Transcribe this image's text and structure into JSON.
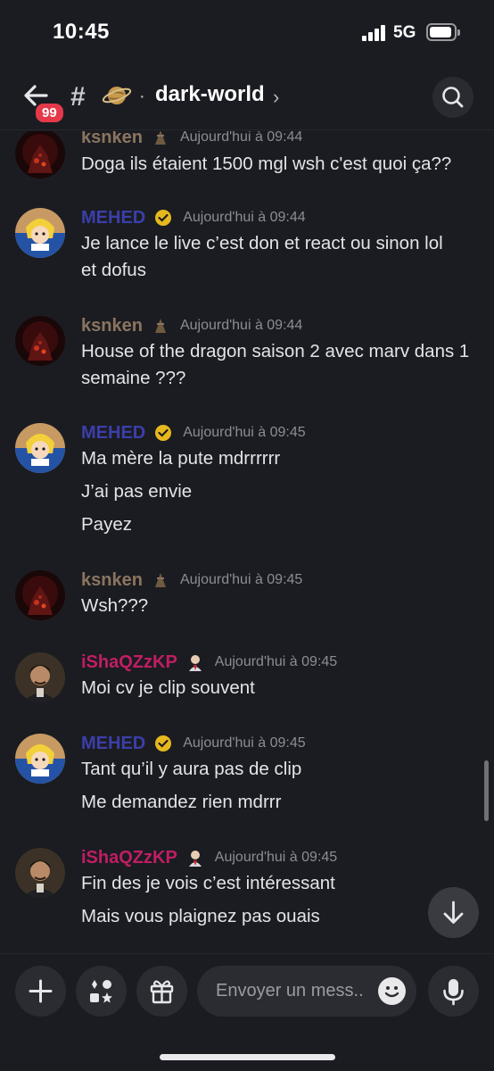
{
  "status_bar": {
    "time": "10:45",
    "network": "5G"
  },
  "header": {
    "badge_count": "99",
    "hash_symbol": "#",
    "separator": "·",
    "channel_name": "dark-world",
    "chevron": "›"
  },
  "messages": [
    {
      "author": "ksnken",
      "timestamp": "Aujourd'hui à 09:44",
      "lines": [
        "Doga ils étaient 1500 mgl wsh c'est quoi ça??"
      ]
    },
    {
      "author": "MEHED",
      "timestamp": "Aujourd'hui à 09:44",
      "lines": [
        "Je lance le live c’est don et react ou sinon lol",
        "et dofus"
      ]
    },
    {
      "author": "ksnken",
      "timestamp": "Aujourd'hui à 09:44",
      "lines": [
        "House of the dragon saison 2 avec marv dans 1",
        "semaine ???"
      ]
    },
    {
      "author": "MEHED",
      "timestamp": "Aujourd'hui à 09:45",
      "lines": [
        "Ma mère la pute mdrrrrrr",
        "J’ai pas envie",
        "Payez"
      ]
    },
    {
      "author": "ksnken",
      "timestamp": "Aujourd'hui à 09:45",
      "lines": [
        "Wsh???"
      ]
    },
    {
      "author": "iShaQZzKP",
      "timestamp": "Aujourd'hui à 09:45",
      "lines": [
        "Moi cv je clip souvent"
      ]
    },
    {
      "author": "MEHED",
      "timestamp": "Aujourd'hui à 09:45",
      "lines": [
        "Tant qu’il y aura pas de clip",
        "Me demandez rien mdrrr"
      ]
    },
    {
      "author": "iShaQZzKP",
      "timestamp": "Aujourd'hui à 09:45",
      "lines": [
        "Fin des je vois c’est intéressant",
        "Mais vous plaignez pas ouais"
      ]
    }
  ],
  "composer": {
    "placeholder": "Envoyer un mess.."
  },
  "colors": {
    "background": "#1b1c21",
    "ksnken": "#8a7560",
    "mehed": "#3b3fa8",
    "ishaq": "#c01e63",
    "badge": "#e5394a"
  },
  "icons": [
    "back-arrow-icon",
    "planet-icon",
    "search-icon",
    "trophy-role-icon",
    "verified-badge-icon",
    "bald-man-role-icon",
    "arrow-down-icon",
    "plus-icon",
    "apps-icon",
    "gift-icon",
    "emoji-icon",
    "microphone-icon"
  ]
}
